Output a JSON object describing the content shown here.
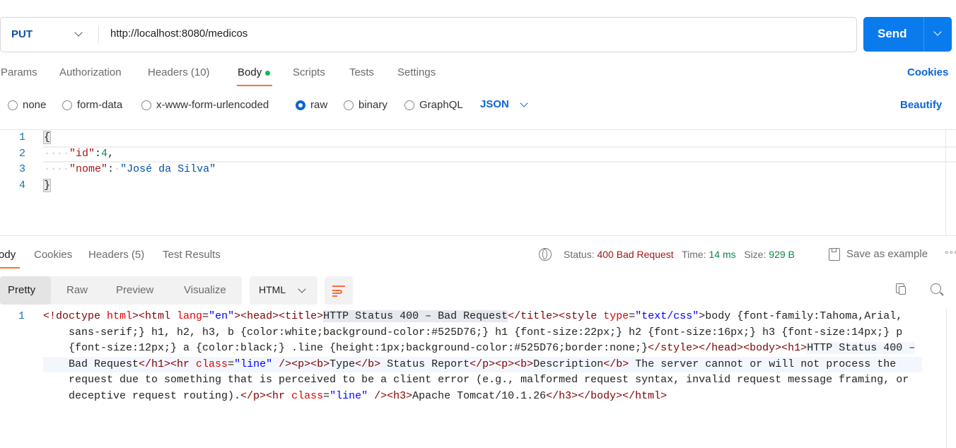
{
  "request": {
    "method": "PUT",
    "url": "http://localhost:8080/medicos",
    "send_label": "Send"
  },
  "tabs": [
    {
      "label": "Params"
    },
    {
      "label": "Authorization"
    },
    {
      "label": "Headers (10)"
    },
    {
      "label": "Body"
    },
    {
      "label": "Scripts"
    },
    {
      "label": "Tests"
    },
    {
      "label": "Settings"
    }
  ],
  "cookies_label": "Cookies",
  "body_types": [
    {
      "label": "none"
    },
    {
      "label": "form-data"
    },
    {
      "label": "x-www-form-urlencoded"
    },
    {
      "label": "raw",
      "selected": true
    },
    {
      "label": "binary"
    },
    {
      "label": "GraphQL"
    }
  ],
  "format": "JSON",
  "beautify_label": "Beautify",
  "editor": {
    "line_numbers": [
      "1",
      "2",
      "3",
      "4"
    ],
    "open": "{",
    "key1": "\"id\"",
    "val1": "4",
    "key2": "\"nome\"",
    "val2": "\"José da Silva\"",
    "close": "}"
  },
  "response": {
    "tabs": [
      {
        "label": "Body"
      },
      {
        "label": "Cookies"
      },
      {
        "label": "Headers (5)"
      },
      {
        "label": "Test Results"
      }
    ],
    "status_label": "Status:",
    "status": "400 Bad Request",
    "time_label": "Time:",
    "time": "14 ms",
    "size_label": "Size:",
    "size": "929 B",
    "save_label": "Save as example",
    "views": [
      {
        "label": "Pretty"
      },
      {
        "label": "Raw"
      },
      {
        "label": "Preview"
      },
      {
        "label": "Visualize"
      }
    ],
    "language": "HTML",
    "line_number": "1",
    "lines": [
      [
        [
          "<!doctype ",
          "tag"
        ],
        [
          "html",
          "attr"
        ],
        [
          "><html ",
          "tag"
        ],
        [
          "lang",
          "attr"
        ],
        [
          "=",
          "txt"
        ],
        [
          "\"en\"",
          "val"
        ],
        [
          "><head><title>",
          "tag"
        ],
        [
          "HTTP Status 400 – Bad Request",
          "hl"
        ],
        [
          "</title><style ",
          "tag"
        ],
        [
          "type",
          "attr"
        ],
        [
          "=",
          "txt"
        ],
        [
          "\"text/css\"",
          "val"
        ],
        [
          ">body {font-family:Tahoma,Arial,",
          "txt"
        ]
      ],
      [
        [
          "sans-serif;} h1, h2, h3, b {color:white;background-color:#525D76;} h1 {font-size:22px;} h2 {font-size:16px;} h3 {font-size:14px;} p",
          "txt"
        ]
      ],
      [
        [
          "{font-size:12px;} a {color:black;} .line {height:1px;background-color:#525D76;border:none;}",
          "txt"
        ],
        [
          "</style></head><body><h1>",
          "tag"
        ],
        [
          "HTTP Status 400 –",
          "hl2"
        ]
      ],
      [
        [
          "Bad Request",
          "hl2"
        ],
        [
          "</h1><hr ",
          "tag"
        ],
        [
          "class",
          "attr"
        ],
        [
          "=",
          "txt"
        ],
        [
          "\"line\"",
          "val"
        ],
        [
          " /><p><b>",
          "tag"
        ],
        [
          "Type",
          "txt"
        ],
        [
          "</b>",
          "tag"
        ],
        [
          " Status Report",
          "txt"
        ],
        [
          "</p><p><b>",
          "tag"
        ],
        [
          "Description",
          "txt"
        ],
        [
          "</b>",
          "tag"
        ],
        [
          " The server cannot or will not process the",
          "txt"
        ]
      ],
      [
        [
          "request due to something that is perceived to be a client error (e.g., malformed request syntax, invalid request message framing, or",
          "txt"
        ]
      ],
      [
        [
          "deceptive request routing).",
          "txt"
        ],
        [
          "</p><hr ",
          "tag"
        ],
        [
          "class",
          "attr"
        ],
        [
          "=",
          "txt"
        ],
        [
          "\"line\"",
          "val"
        ],
        [
          " /><h3>",
          "tag"
        ],
        [
          "Apache Tomcat/10.1.26",
          "txt"
        ],
        [
          "</h3></body></html>",
          "tag"
        ]
      ]
    ]
  },
  "colors": {
    "accent": "#097bed",
    "status_error": "#a31515",
    "success": "#0a8a45",
    "active_tab": "#ff6c37"
  }
}
